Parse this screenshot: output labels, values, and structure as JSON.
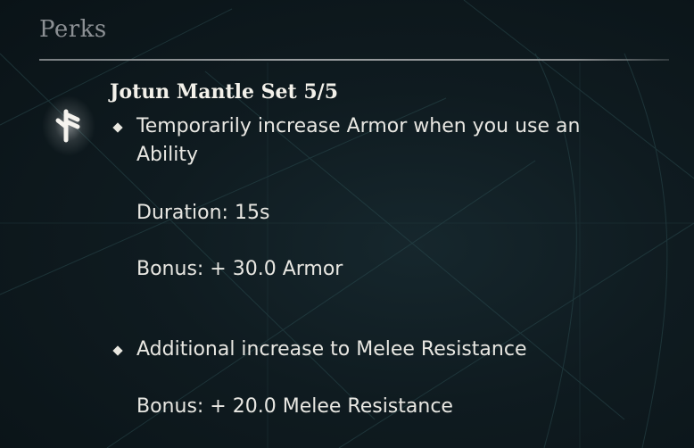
{
  "section": {
    "title": "Perks"
  },
  "perk": {
    "icon": "rune-icon",
    "name": "Jotun Mantle Set 5/5",
    "effects": [
      {
        "description_line1": "Temporarily increase Armor when you use an",
        "description_line2": "Ability",
        "duration": "Duration: 15s",
        "bonus": "Bonus: + 30.0 Armor"
      },
      {
        "description_line1": "Additional increase to Melee Resistance",
        "bonus": "Bonus: + 20.0 Melee Resistance"
      }
    ]
  },
  "colors": {
    "background": "#0f1b20",
    "text": "#e8e7e2",
    "muted_title": "#8c9094",
    "divider": "#8a8e90"
  }
}
